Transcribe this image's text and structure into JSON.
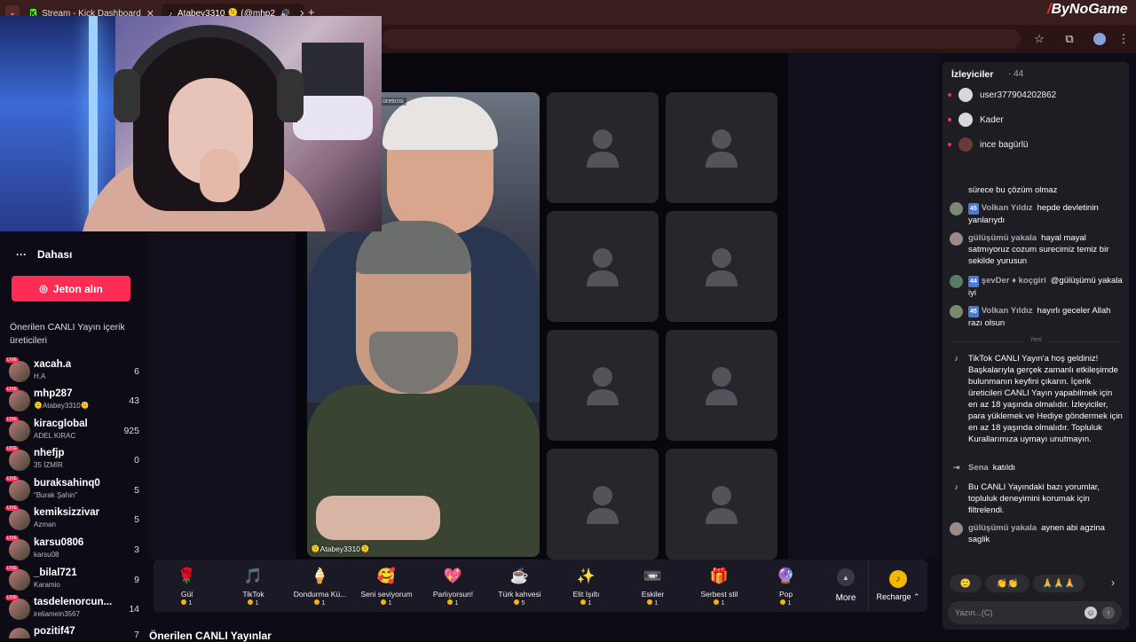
{
  "browser": {
    "tabs": [
      {
        "label": "Stream - Kick Dashboard"
      },
      {
        "label": "Atabey3310 🫠 (@mhp2"
      }
    ],
    "brand": "ByNoGame",
    "new_tab": "+",
    "close": "✕"
  },
  "sidebar": {
    "more_label": "Dahası",
    "coins_button": "Jeton alın",
    "suggested_title": "Önerilen CANLI Yayın içerik üreticileri",
    "creators": [
      {
        "name": "xacah.a",
        "sub": "H.A",
        "count": "6"
      },
      {
        "name": "mhp287",
        "sub": "🫠Atabey3310🫠",
        "count": "43"
      },
      {
        "name": "kiracglobal",
        "sub": "ADEL KIRAC",
        "count": "925"
      },
      {
        "name": "nhefjp",
        "sub": "35 İZMİR",
        "count": "0"
      },
      {
        "name": "buraksahinq0",
        "sub": "\"Burak Şahin\"",
        "count": "5"
      },
      {
        "name": "kemiksizzivar",
        "sub": "Azman",
        "count": "5"
      },
      {
        "name": "karsu0806",
        "sub": "karsu08",
        "count": "3"
      },
      {
        "name": "_bilal721",
        "sub": "Karamio",
        "count": "9"
      },
      {
        "name": "tasdelenorcun...",
        "sub": "ireliamein3567",
        "count": "14"
      },
      {
        "name": "pozitif47",
        "sub": "",
        "count": "7"
      }
    ]
  },
  "stage": {
    "host_tag": "üreticisi",
    "host_name": "🫠Atabey3310🫠"
  },
  "gifts": [
    {
      "name": "Gül",
      "price": "1",
      "icon": "🌹"
    },
    {
      "name": "TikTok",
      "price": "1",
      "icon": "🎵"
    },
    {
      "name": "Dondurma Kü...",
      "price": "1",
      "icon": "🍦"
    },
    {
      "name": "Seni seviyorum",
      "price": "1",
      "icon": "🥰"
    },
    {
      "name": "Parlıyorsun!",
      "price": "1",
      "icon": "💖"
    },
    {
      "name": "Türk kahvesi",
      "price": "5",
      "icon": "☕"
    },
    {
      "name": "Elit Işıltı",
      "price": "1",
      "icon": "✨"
    },
    {
      "name": "Eskiler",
      "price": "1",
      "icon": "📼"
    },
    {
      "name": "Serbest stil",
      "price": "1",
      "icon": "🎁"
    },
    {
      "name": "Pop",
      "price": "1",
      "icon": "🔮"
    }
  ],
  "gift_more": "More",
  "recharge": "Recharge ⌃",
  "bottom_title": "Önerilen CANLI Yayınlar",
  "chat": {
    "viewers_title": "İzleyiciler",
    "viewers_count": "· 44",
    "viewers": [
      {
        "name": "user377904202862"
      },
      {
        "name": "Kader"
      },
      {
        "name": "ince bagürlü"
      }
    ],
    "messages": [
      {
        "level": "",
        "name": "",
        "text": "sürece bu çözüm olmaz"
      },
      {
        "level": "45",
        "name": "Volkan Yıldız",
        "text": "hepde devletinin yanlarıydı"
      },
      {
        "level": "",
        "name": "gülüşümü yakala",
        "text": "hayal mayal satmıyoruz cozum surecimiz temiz bir sekilde yurusun"
      },
      {
        "level": "44",
        "name": "şevDer ♦ koçgiri",
        "text": "@gülüşümü yakala iyi"
      },
      {
        "level": "45",
        "name": "Volkan Yıldız",
        "text": "hayırlı geceler Allah razı olsun"
      }
    ],
    "divider": "Yeni",
    "system_welcome": "TikTok CANLI Yayın'a hoş geldiniz! Başkalarıyla gerçek zamanlı etkileşimde bulunmanın keyfini çıkarın. İçerik üreticileri CANLI Yayın yapabilmek için en az 18 yaşında olmalıdır. İzleyiciler, para yüklemek ve Hediye göndermek için en az 18 yaşında olmalıdır. Topluluk Kurallarımıza uymayı unutmayın.",
    "joined_name": "Sena",
    "joined_text": "katıldı",
    "system_filter": "Bu CANLI Yayındaki bazı yorumlar, topluluk deneyimini korumak için filtrelendi.",
    "last_name": "gülüşümü yakala",
    "last_text": "aynen abi agzina saglik",
    "reactions": [
      "🙂",
      "👏👏",
      "🙏🙏🙏"
    ],
    "input_placeholder": "Yazın...(C)"
  }
}
